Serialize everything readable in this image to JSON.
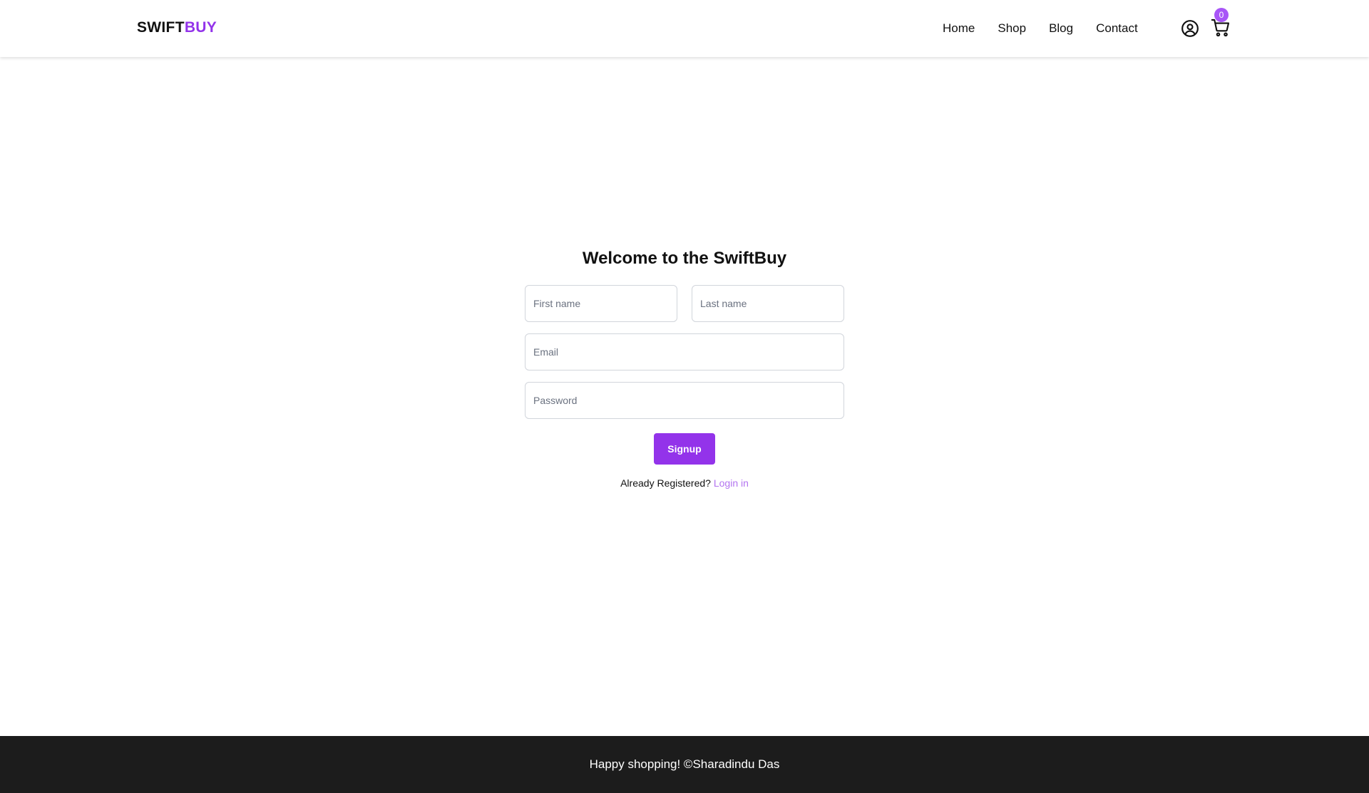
{
  "brand": {
    "part1": "SWIFT",
    "part2": "BUY",
    "accent_color": "#9333ea"
  },
  "nav": {
    "links": [
      {
        "label": "Home"
      },
      {
        "label": "Shop"
      },
      {
        "label": "Blog"
      },
      {
        "label": "Contact"
      }
    ],
    "icons": [
      "user-circle-icon",
      "cart-icon"
    ],
    "cart_count": "0"
  },
  "signup": {
    "title": "Welcome to the SwiftBuy",
    "first_name_placeholder": "First name",
    "first_name_value": "",
    "last_name_placeholder": "Last name",
    "last_name_value": "",
    "email_placeholder": "Email",
    "email_value": "",
    "password_placeholder": "Password",
    "password_value": "",
    "button_label": "Signup",
    "already_text": "Already Registered?",
    "login_link": "Login in"
  },
  "footer": {
    "text": "Happy shopping! ©Sharadindu Das",
    "background": "#1c1c1c"
  }
}
